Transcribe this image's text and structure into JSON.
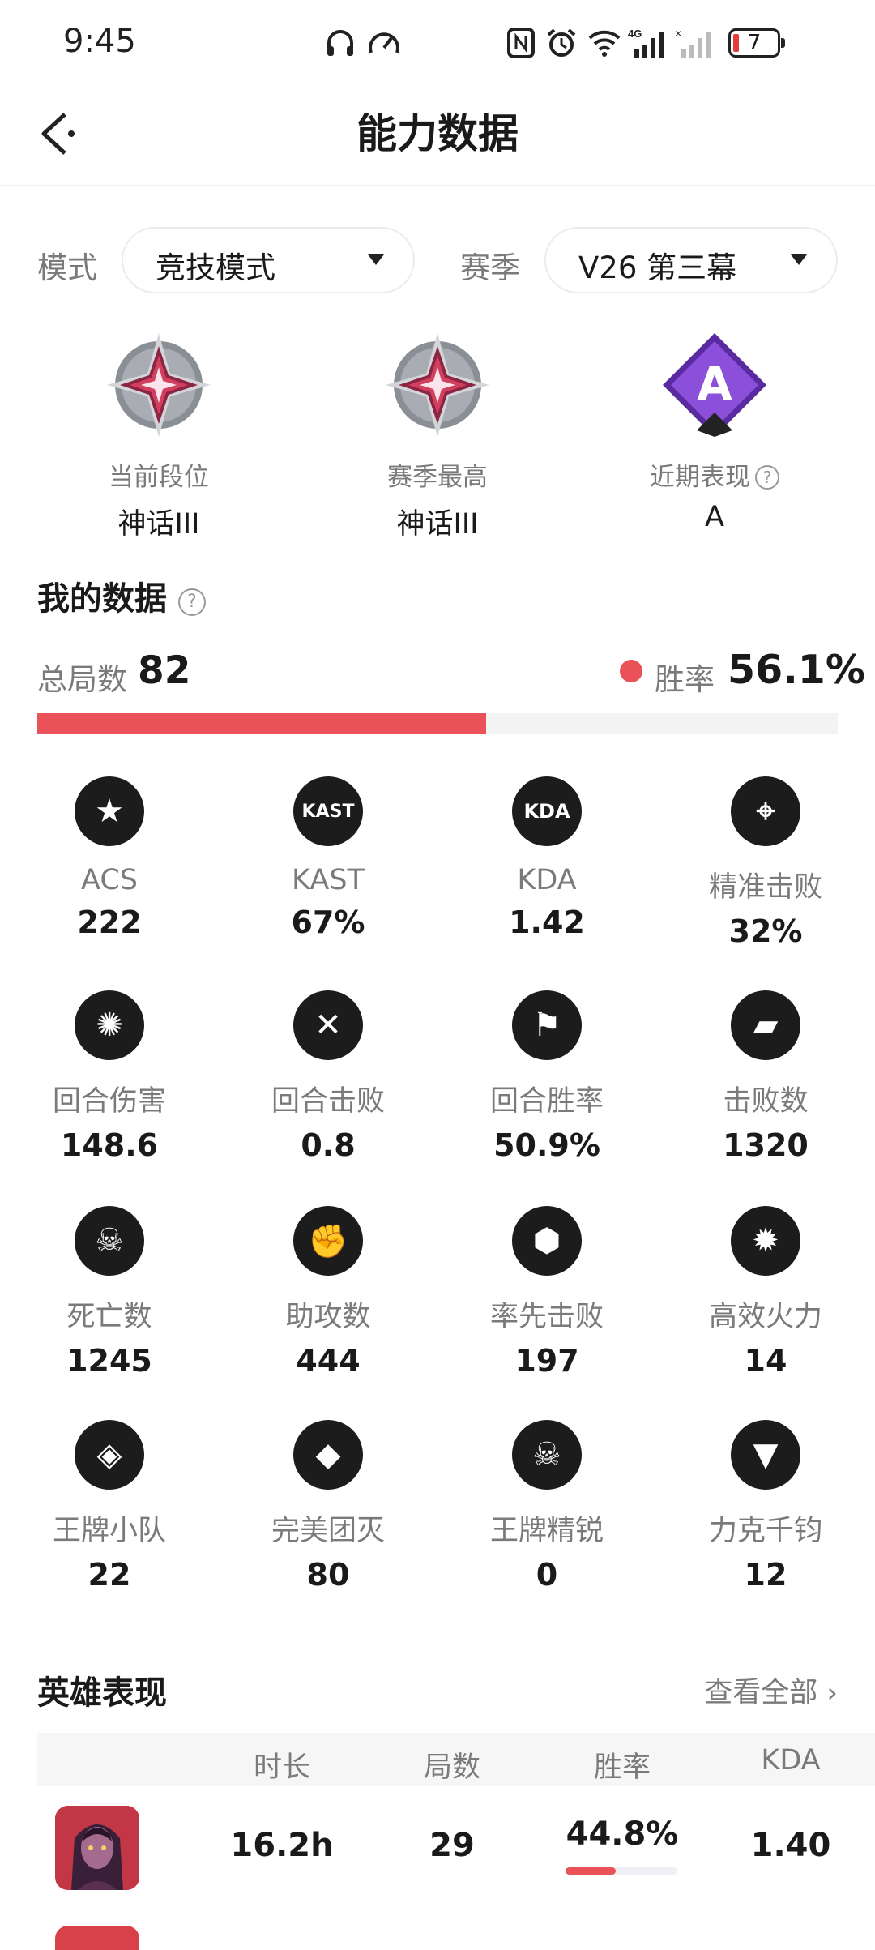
{
  "status_bar": {
    "time": "9:45",
    "battery": "7"
  },
  "header": {
    "title": "能力数据"
  },
  "filters": {
    "mode_label": "模式",
    "mode_value": "竞技模式",
    "season_label": "赛季",
    "season_value": "V26 第三幕"
  },
  "ranks": [
    {
      "label": "当前段位",
      "value": "神话III"
    },
    {
      "label": "赛季最高",
      "value": "神话III"
    },
    {
      "label": "近期表现",
      "value": "A",
      "emblem_letter": "A"
    }
  ],
  "my_data": {
    "title": "我的数据",
    "total_label": "总局数",
    "total_value": "82",
    "win_label": "胜率",
    "win_value": "56.1%",
    "win_rate": 0.561
  },
  "stats": [
    {
      "icon": "star-hexagon-icon",
      "label": "ACS",
      "value": "222",
      "glyph": "★"
    },
    {
      "icon": "kast-icon",
      "label": "KAST",
      "value": "67%",
      "glyph": "KAST"
    },
    {
      "icon": "kda-icon",
      "label": "KDA",
      "value": "1.42",
      "glyph": "KDA"
    },
    {
      "icon": "crosshair-skull-icon",
      "label": "精准击败",
      "value": "32%",
      "glyph": "⌖"
    },
    {
      "icon": "impact-icon",
      "label": "回合伤害",
      "value": "148.6",
      "glyph": "✺"
    },
    {
      "icon": "crossed-blades-icon",
      "label": "回合击败",
      "value": "0.8",
      "glyph": "✕"
    },
    {
      "icon": "flag-icon",
      "label": "回合胜率",
      "value": "50.9%",
      "glyph": "⚑"
    },
    {
      "icon": "pistol-icon",
      "label": "击败数",
      "value": "1320",
      "glyph": "▰"
    },
    {
      "icon": "skull-icon",
      "label": "死亡数",
      "value": "1245",
      "glyph": "☠"
    },
    {
      "icon": "fist-icon",
      "label": "助攻数",
      "value": "444",
      "glyph": "✊"
    },
    {
      "icon": "first-blood-icon",
      "label": "率先击败",
      "value": "197",
      "glyph": "⬢"
    },
    {
      "icon": "firepower-icon",
      "label": "高效火力",
      "value": "14",
      "glyph": "✹"
    },
    {
      "icon": "ace-team-icon",
      "label": "王牌小队",
      "value": "22",
      "glyph": "◈"
    },
    {
      "icon": "diamond-gem-icon",
      "label": "完美团灭",
      "value": "80",
      "glyph": "◆"
    },
    {
      "icon": "elite-skull-icon",
      "label": "王牌精锐",
      "value": "0",
      "glyph": "☠"
    },
    {
      "icon": "eagle-icon",
      "label": "力克千钧",
      "value": "12",
      "glyph": "▼"
    }
  ],
  "heroes": {
    "title": "英雄表现",
    "view_all": "查看全部",
    "columns": [
      "时长",
      "局数",
      "胜率",
      "KDA"
    ],
    "rows": [
      {
        "duration": "16.2h",
        "matches": "29",
        "win_rate": "44.8%",
        "win_fraction": 0.448,
        "kda": "1.40"
      }
    ]
  },
  "colors": {
    "accent": "#ea5159",
    "icon_bg": "#1c1c1c",
    "muted": "#7a7a7a"
  }
}
